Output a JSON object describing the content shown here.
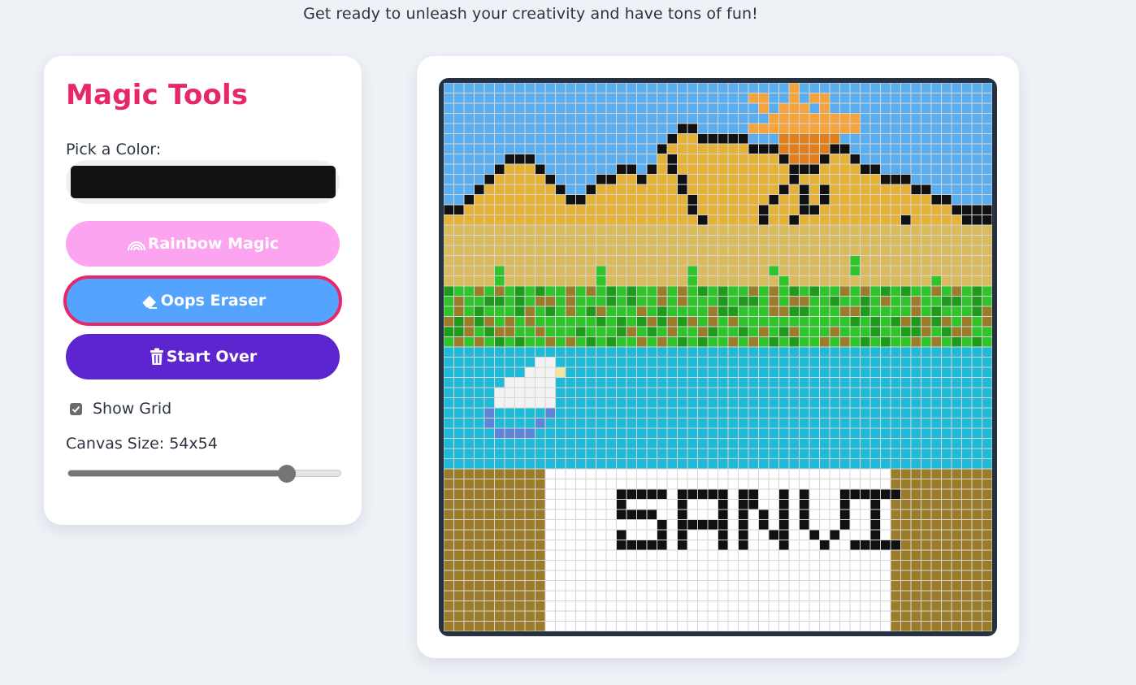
{
  "header": {
    "tagline": "Get ready to unleash your creativity and have tons of fun!"
  },
  "tools": {
    "title": "Magic Tools",
    "color_label": "Pick a Color:",
    "selected_color": "#111111",
    "rainbow_label": "Rainbow Magic",
    "rainbow_icon": "rainbow-icon",
    "rainbow_color": "#fda4f0",
    "eraser_label": "Oops Eraser",
    "eraser_icon": "eraser-icon",
    "eraser_color": "#54a3ff",
    "eraser_active": true,
    "clear_label": "Start Over",
    "clear_icon": "trash-icon",
    "clear_color": "#5d25d0",
    "active_border_color": "#e8266a",
    "show_grid_label": "Show Grid",
    "show_grid": true,
    "canvas_size_label": "Canvas Size: 54x54",
    "canvas_size": 54,
    "canvas_size_fraction": 0.8
  },
  "canvas": {
    "grid_size": 54,
    "grid_line_color": "#d6d6d6",
    "palette": {
      "sky": "#5aaef0",
      "sun_orange": "#f4a43c",
      "sun_dark": "#e07e1c",
      "mountain": "#e4b236",
      "outline": "#111111",
      "sand": "#d9ba5c",
      "grass": "#2fc42a",
      "grass_dark": "#1f9a1c",
      "dirt": "#9a7c2a",
      "water": "#1fbad6",
      "cloud": "#f2f2f2",
      "cloud_shadow": "#5b86d8",
      "cloud_accent": "#f0e6a0",
      "sign": "#ffffff"
    },
    "sign_text": "SANVI"
  }
}
